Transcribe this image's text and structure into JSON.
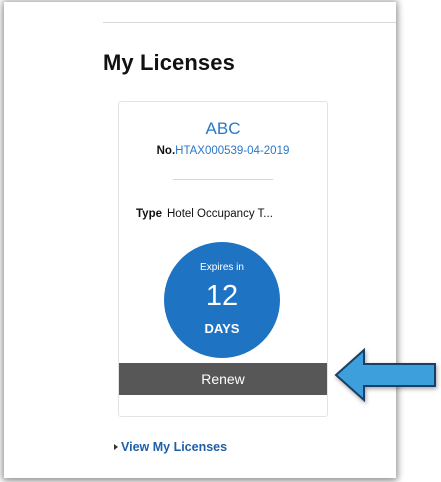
{
  "page": {
    "title": "My Licenses"
  },
  "license": {
    "name": "ABC",
    "number_label": "No.",
    "number": "HTAX000539-04-2019",
    "type_label": "Type",
    "type_value": "Hotel Occupancy T...",
    "expiry": {
      "prefix": "Expires in",
      "count": "12",
      "unit": "DAYS"
    },
    "renew_label": "Renew"
  },
  "footer": {
    "view_link": "View My Licenses"
  },
  "colors": {
    "accent_blue": "#1f73c3",
    "link_blue": "#2a78c6",
    "renew_bg": "#575757",
    "arrow_fill": "#3d9fdc"
  },
  "icons": {
    "link_caret": "caret-right-icon",
    "callout": "left-arrow-icon"
  }
}
